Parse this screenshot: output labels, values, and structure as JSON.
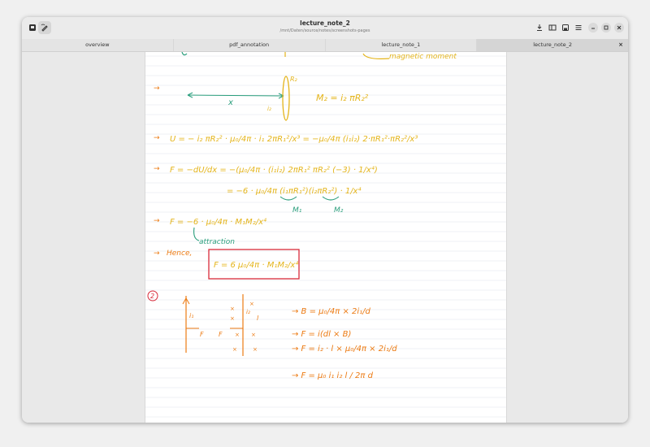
{
  "window": {
    "title": "lecture_note_2",
    "subtitle": "/mnt/Daten/source/notes/screenshots-pages"
  },
  "toolbar_icons": {
    "left": [
      "document-icon",
      "annotate-icon"
    ],
    "right": [
      "download-icon",
      "sidebar-icon",
      "save-icon",
      "menu-icon"
    ]
  },
  "window_controls": [
    "minimize",
    "maximize",
    "close"
  ],
  "tabs": [
    {
      "label": "overview"
    },
    {
      "label": "pdf_annotation"
    },
    {
      "label": "lecture_note_1"
    },
    {
      "label": "lecture_note_2",
      "active": true
    }
  ],
  "tab_close_glyph": "×",
  "colors": {
    "ink_yellow": "#e4b41a",
    "ink_green": "#2a9e7c",
    "ink_orange": "#ec7a12",
    "ink_red": "#d92b3a",
    "ink_brown": "#b07a16",
    "rule_line": "#dfe4ee"
  },
  "note": {
    "top_partial": "magnetic moment",
    "r2_label": "R₂",
    "x_label": "x",
    "i2_label": "i₂",
    "m2_eq": "M₂ = i₂ πR₂²",
    "u_eq": "U = − i₂ πR₂² · μ₀/4π · i₁ 2πR₁²/x³ = −μ₀/4π (i₁i₂) 2·πR₁²·πR₂²/x³",
    "f_eq1": "F = −dU/dx = −(μ₀/4π · (i₁i₂) 2πR₁² πR₂² (−3) · 1/x⁴)",
    "f_eq2": "= −6 · μ₀/4π (i₁πR₁²)(i₂πR₂²) · 1/x⁴",
    "m1_label": "M₁",
    "m2_label": "M₂",
    "f_eq3": "F = −6 · μ₀/4π · M₁M₂/x⁴",
    "attraction": "attraction",
    "hence": "Hence,",
    "boxed": "F = 6 μ₀/4π · M₁M₂/x⁴",
    "q2_number": "2",
    "q2_i1": "i₁",
    "q2_i2": "i₂",
    "q2_F": "F",
    "q2_l": "l",
    "b_eq": "→ B = μ₀/4π × 2i₁/d",
    "f_b_eq": "→ F = i(dl × B)",
    "f_il_eq": "→ F = i₂ · l × μ₀/4π × 2i₁/d",
    "final_eq": "→ F = μ₀ i₁ i₂ l / 2π d"
  }
}
